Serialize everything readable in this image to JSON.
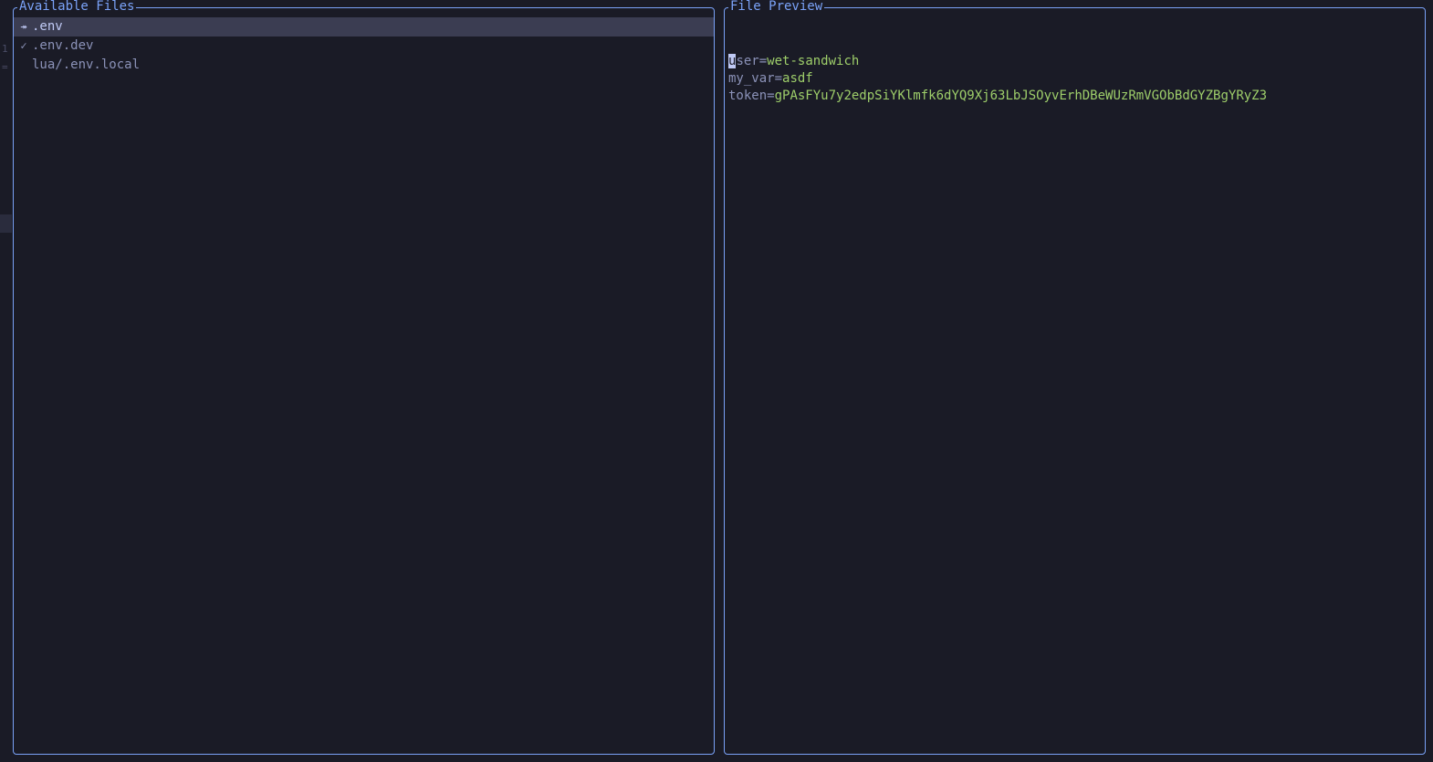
{
  "panels": {
    "left": {
      "title": "Available Files"
    },
    "right": {
      "title": "File Preview"
    }
  },
  "files": [
    {
      "marker": "↠",
      "name": ".env",
      "selected": true
    },
    {
      "marker": "✓",
      "name": ".env.dev",
      "selected": false
    },
    {
      "marker": " ",
      "name": "lua/.env.local",
      "selected": false
    }
  ],
  "preview": [
    {
      "key": "user",
      "value": "wet-sandwich",
      "cursor_first": true
    },
    {
      "key": "my_var",
      "value": "asdf",
      "cursor_first": false
    },
    {
      "key": "token",
      "value": "gPAsFYu7y2edpSiYKlmfk6dYQ9Xj63LbJSOyvErhDBeWUzRmVGObBdGYZBgYRyZ3",
      "cursor_first": false
    }
  ],
  "gutter": {
    "num": "1",
    "sym": "="
  }
}
